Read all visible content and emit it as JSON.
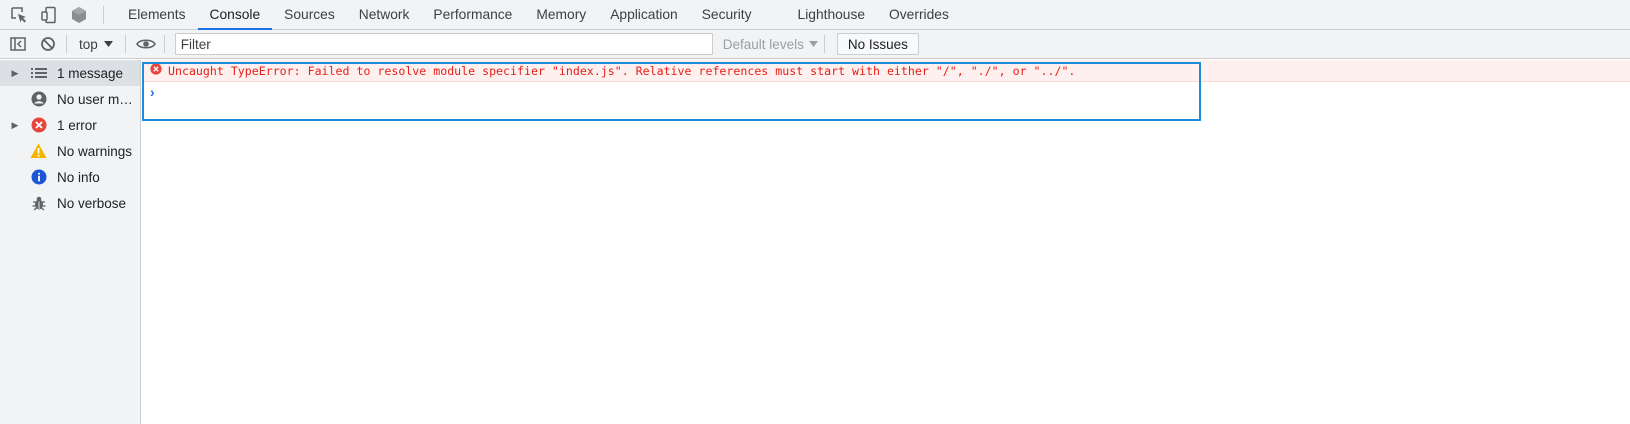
{
  "devtools": {
    "tabs": [
      {
        "label": "Elements"
      },
      {
        "label": "Console"
      },
      {
        "label": "Sources"
      },
      {
        "label": "Network"
      },
      {
        "label": "Performance"
      },
      {
        "label": "Memory"
      },
      {
        "label": "Application"
      },
      {
        "label": "Security"
      },
      {
        "label": "Lighthouse"
      },
      {
        "label": "Overrides"
      }
    ],
    "active_tab": "Console",
    "toolbar_icons": [
      "inspect-element-icon",
      "device-toolbar-icon",
      "node-icon"
    ]
  },
  "toolbar": {
    "context": "top",
    "filter_placeholder": "Filter",
    "levels_label": "Default levels",
    "issues_label": "No Issues"
  },
  "sidebar": {
    "items": [
      {
        "label": "1 message",
        "icon": "list-icon",
        "expandable": true,
        "selected": true
      },
      {
        "label": "No user me...",
        "icon": "user-icon",
        "expandable": false
      },
      {
        "label": "1 error",
        "icon": "error-icon",
        "expandable": true
      },
      {
        "label": "No warnings",
        "icon": "warning-icon",
        "expandable": false
      },
      {
        "label": "No info",
        "icon": "info-icon",
        "expandable": false
      },
      {
        "label": "No verbose",
        "icon": "bug-icon",
        "expandable": false
      }
    ]
  },
  "console": {
    "messages": [
      {
        "level": "error",
        "text": "Uncaught TypeError: Failed to resolve module specifier \"index.js\". Relative references must start with either \"/\", \"./\", or \"../\"."
      }
    ],
    "prompt_symbol": "›"
  },
  "colors": {
    "accent": "#1a73e8",
    "error_text": "#e62117",
    "error_bg": "#fff0f0",
    "warning": "#f4b400",
    "info": "#1a56d6",
    "focus_border": "#1a8fd8"
  }
}
